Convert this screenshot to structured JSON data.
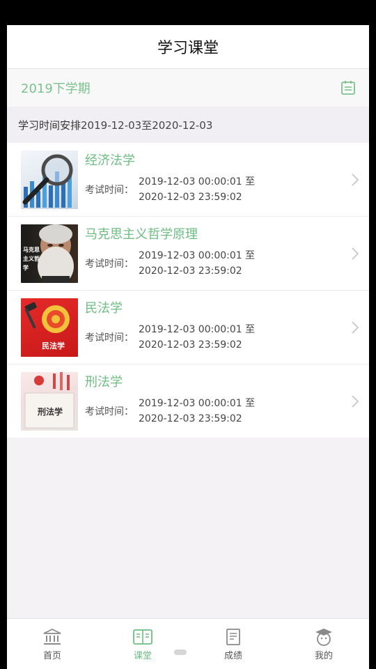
{
  "header": {
    "title": "学习课堂"
  },
  "semester": {
    "label": "2019下学期"
  },
  "schedule": {
    "label": "学习时间安排",
    "range": "2019-12-03至2020-12-03"
  },
  "courses": [
    {
      "name": "经济法学",
      "exam_label": "考试时间：",
      "start": "2019-12-03 00:00:01 至",
      "end": "2020-12-03 23:59:02"
    },
    {
      "name": "马克思主义哲学原理",
      "exam_label": "考试时间：",
      "start": "2019-12-03 00:00:01 至",
      "end": "2020-12-03 23:59:02",
      "thumb_text": "马克思主义哲学"
    },
    {
      "name": "民法学",
      "exam_label": "考试时间：",
      "start": "2019-12-03 00:00:01 至",
      "end": "2020-12-03 23:59:02",
      "thumb_text": "民法学"
    },
    {
      "name": "刑法学",
      "exam_label": "考试时间：",
      "start": "2019-12-03 00:00:01 至",
      "end": "2020-12-03 23:59:02",
      "thumb_text": "刑法学"
    }
  ],
  "nav": [
    {
      "label": "首页",
      "icon": "bank-icon"
    },
    {
      "label": "课堂",
      "icon": "book-icon",
      "active": true
    },
    {
      "label": "成绩",
      "icon": "report-icon"
    },
    {
      "label": "我的",
      "icon": "student-avatar-icon"
    }
  ],
  "colors": {
    "accent": "#6dbd82",
    "background": "#f4f2f5"
  }
}
